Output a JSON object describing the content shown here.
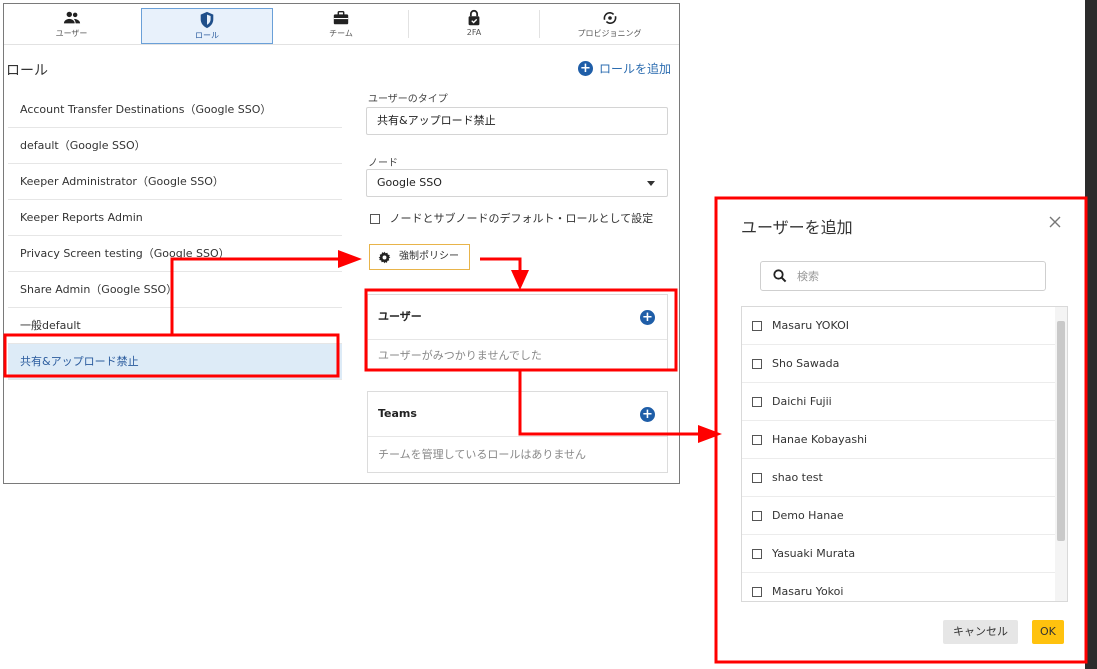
{
  "tabs": [
    {
      "label": "ユーザー",
      "icon": "users-icon"
    },
    {
      "label": "ロール",
      "icon": "shield-icon",
      "active": true
    },
    {
      "label": "チーム",
      "icon": "briefcase-icon"
    },
    {
      "label": "2FA",
      "icon": "lock-icon"
    },
    {
      "label": "プロビジョニング",
      "icon": "provisioning-icon"
    }
  ],
  "roles": {
    "title": "ロール",
    "add_label": "ロールを追加",
    "items": [
      "Account Transfer Destinations（Google SSO）",
      "default（Google SSO）",
      "Keeper Administrator（Google SSO）",
      "Keeper Reports Admin",
      "Privacy Screen testing（Google SSO）",
      "Share Admin（Google SSO）",
      "一般default",
      "共有&アップロード禁止"
    ],
    "selected_index": 7
  },
  "detail": {
    "user_type_label": "ユーザーのタイプ",
    "user_type_value": "共有&アップロード禁止",
    "node_label": "ノード",
    "node_value": "Google SSO",
    "default_role_label": "ノードとサブノードのデフォルト・ロールとして設定",
    "policy_button": "強制ポリシー",
    "users_card": {
      "title": "ユーザー",
      "empty": "ユーザーがみつかりませんでした"
    },
    "teams_card": {
      "title": "Teams",
      "empty": "チームを管理しているロールはありません"
    }
  },
  "dialog": {
    "title": "ユーザーを追加",
    "search_placeholder": "検索",
    "users": [
      "Masaru YOKOI",
      "Sho Sawada",
      "Daichi Fujii",
      "Hanae Kobayashi",
      "shao test",
      "Demo Hanae",
      "Yasuaki Murata",
      "Masaru Yokoi"
    ],
    "cancel_label": "キャンセル",
    "ok_label": "OK"
  },
  "colors": {
    "highlight_red": "#ff0000",
    "accent_blue": "#1f5ea8",
    "ok_yellow": "#ffc20e",
    "policy_border": "#e8b44a"
  }
}
